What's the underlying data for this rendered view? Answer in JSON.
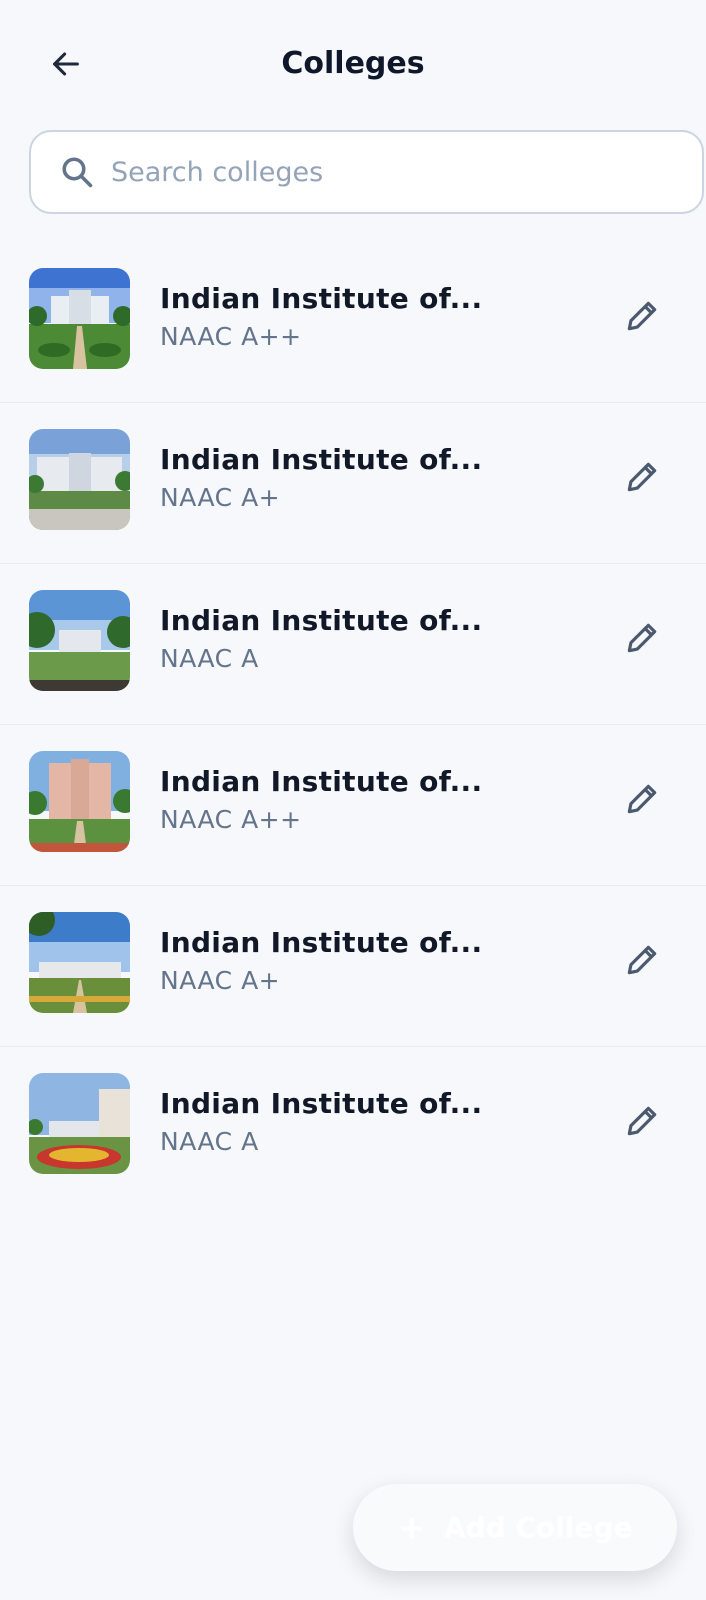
{
  "header": {
    "title": "Colleges",
    "back_icon": "arrow-left-icon"
  },
  "search": {
    "placeholder": "Search colleges",
    "value": "",
    "icon": "search-icon"
  },
  "colleges": [
    {
      "name": "Indian Institute of...",
      "grade": "NAAC A++"
    },
    {
      "name": "Indian Institute of...",
      "grade": "NAAC A+"
    },
    {
      "name": "Indian Institute of...",
      "grade": "NAAC A"
    },
    {
      "name": "Indian Institute of...",
      "grade": "NAAC A++"
    },
    {
      "name": "Indian Institute of...",
      "grade": "NAAC A+"
    },
    {
      "name": "Indian Institute of...",
      "grade": "NAAC A"
    }
  ],
  "fab": {
    "label": "Add College",
    "icon": "plus-icon"
  },
  "colors": {
    "background": "#f7f8fb",
    "text": "#111827",
    "muted": "#64748b",
    "border": "#cbd5e1"
  }
}
